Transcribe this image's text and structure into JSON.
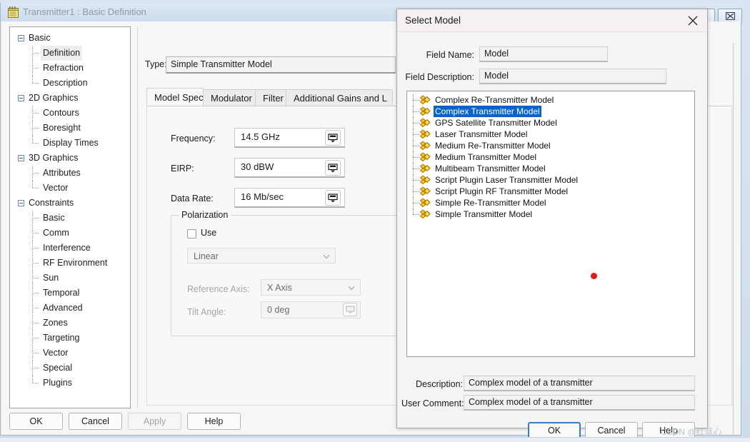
{
  "window": {
    "title": "Transmitter1 : Basic Definition",
    "icon": "document-list-icon",
    "minimize_label": "▭",
    "close_label": "✕"
  },
  "sidebar": {
    "items": [
      {
        "label": "Basic",
        "level": 0,
        "expanded": true,
        "selected": false
      },
      {
        "label": "Definition",
        "level": 1,
        "expanded": false,
        "selected": true
      },
      {
        "label": "Refraction",
        "level": 1,
        "expanded": false,
        "selected": false
      },
      {
        "label": "Description",
        "level": 1,
        "expanded": false,
        "selected": false
      },
      {
        "label": "2D Graphics",
        "level": 0,
        "expanded": true,
        "selected": false
      },
      {
        "label": "Contours",
        "level": 1,
        "expanded": false,
        "selected": false
      },
      {
        "label": "Boresight",
        "level": 1,
        "expanded": false,
        "selected": false
      },
      {
        "label": "Display Times",
        "level": 1,
        "expanded": false,
        "selected": false
      },
      {
        "label": "3D Graphics",
        "level": 0,
        "expanded": true,
        "selected": false
      },
      {
        "label": "Attributes",
        "level": 1,
        "expanded": false,
        "selected": false
      },
      {
        "label": "Vector",
        "level": 1,
        "expanded": false,
        "selected": false
      },
      {
        "label": "Constraints",
        "level": 0,
        "expanded": true,
        "selected": false
      },
      {
        "label": "Basic",
        "level": 1,
        "expanded": false,
        "selected": false
      },
      {
        "label": "Comm",
        "level": 1,
        "expanded": false,
        "selected": false
      },
      {
        "label": "Interference",
        "level": 1,
        "expanded": false,
        "selected": false
      },
      {
        "label": "RF Environment",
        "level": 1,
        "expanded": false,
        "selected": false
      },
      {
        "label": "Sun",
        "level": 1,
        "expanded": false,
        "selected": false
      },
      {
        "label": "Temporal",
        "level": 1,
        "expanded": false,
        "selected": false
      },
      {
        "label": "Advanced",
        "level": 1,
        "expanded": false,
        "selected": false
      },
      {
        "label": "Zones",
        "level": 1,
        "expanded": false,
        "selected": false
      },
      {
        "label": "Targeting",
        "level": 1,
        "expanded": false,
        "selected": false
      },
      {
        "label": "Vector",
        "level": 1,
        "expanded": false,
        "selected": false
      },
      {
        "label": "Special",
        "level": 1,
        "expanded": false,
        "selected": false
      },
      {
        "label": "Plugins",
        "level": 1,
        "expanded": false,
        "selected": false
      }
    ]
  },
  "content": {
    "type_label": "Type:",
    "type_value": "Simple Transmitter Model",
    "ellipsis_label": "...",
    "tabs": [
      {
        "label": "Model Specs",
        "active": true
      },
      {
        "label": "Modulator",
        "active": false
      },
      {
        "label": "Filter",
        "active": false
      },
      {
        "label": "Additional Gains and L",
        "active": false
      }
    ],
    "fields": [
      {
        "label": "Frequency:",
        "value": "14.5 GHz",
        "unit_icon": "unit-picker-icon"
      },
      {
        "label": "EIRP:",
        "value": "30 dBW",
        "unit_icon": "unit-picker-icon"
      },
      {
        "label": "Data Rate:",
        "value": "16 Mb/sec",
        "unit_icon": "unit-picker-icon"
      }
    ],
    "polarization": {
      "title": "Polarization",
      "use_label": "Use",
      "use_checked": false,
      "type_value": "Linear",
      "reference_axis_label": "Reference Axis:",
      "reference_axis_value": "X Axis",
      "tilt_angle_label": "Tilt Angle:",
      "tilt_angle_value": "0 deg",
      "tilt_unit_icon": "unit-picker-icon"
    }
  },
  "main_buttons": [
    {
      "label": "OK",
      "disabled": false
    },
    {
      "label": "Cancel",
      "disabled": false
    },
    {
      "label": "Apply",
      "disabled": true
    },
    {
      "label": "Help",
      "disabled": false
    }
  ],
  "dialog": {
    "title": "Select Model",
    "close_label": "✕",
    "field_name_label": "Field Name:",
    "field_name_value": "Model",
    "field_description_label": "Field Description:",
    "field_description_value": "Model",
    "models": [
      {
        "label": "Complex Re-Transmitter Model",
        "selected": false
      },
      {
        "label": "Complex Transmitter Model",
        "selected": true
      },
      {
        "label": "GPS Satellite Transmitter Model",
        "selected": false
      },
      {
        "label": "Laser Transmitter Model",
        "selected": false
      },
      {
        "label": "Medium Re-Transmitter Model",
        "selected": false
      },
      {
        "label": "Medium Transmitter Model",
        "selected": false
      },
      {
        "label": "Multibeam Transmitter Model",
        "selected": false
      },
      {
        "label": "Script Plugin Laser Transmitter Model",
        "selected": false
      },
      {
        "label": "Script Plugin RF Transmitter Model",
        "selected": false
      },
      {
        "label": "Simple Re-Transmitter Model",
        "selected": false
      },
      {
        "label": "Simple Transmitter Model",
        "selected": false
      }
    ],
    "description_label": "Description:",
    "description_value": "Complex model of a transmitter",
    "user_comment_label": "User Comment:",
    "user_comment_value": "Complex model of a transmitter",
    "buttons": [
      {
        "label": "OK",
        "default": true
      },
      {
        "label": "Cancel",
        "default": false
      },
      {
        "label": "Help",
        "default": false
      }
    ]
  },
  "watermark": {
    "text": "CSDN @红蓝心"
  },
  "colors": {
    "selection_blue": "#0a64c8",
    "titlebar": "#dce7f3",
    "dialog_titlebar": "#f6f0f4",
    "accent_red": "#e01b1b",
    "default_button_border": "#2c7fd0"
  }
}
